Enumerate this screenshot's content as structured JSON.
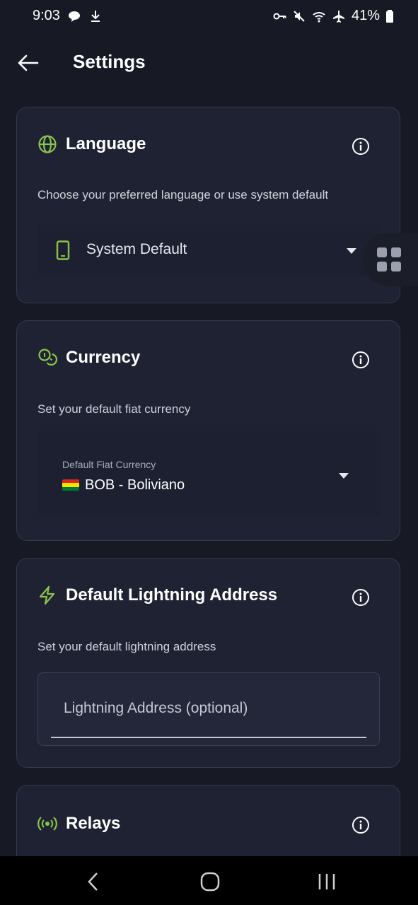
{
  "status_bar": {
    "time": "9:03",
    "battery": "41%",
    "icons": [
      "chat-bubble-icon",
      "download-icon",
      "vpn-key-icon",
      "mute-icon",
      "wifi-icon",
      "airplane-icon",
      "battery-icon"
    ]
  },
  "header": {
    "title": "Settings"
  },
  "language": {
    "title": "Language",
    "description": "Choose your preferred language or use system default",
    "selected": "System Default"
  },
  "currency": {
    "title": "Currency",
    "description": "Set your default fiat currency",
    "field_label": "Default Fiat Currency",
    "selected": "BOB - Boliviano"
  },
  "lightning": {
    "title": "Default Lightning Address",
    "description": "Set your default lightning address",
    "placeholder": "Lightning Address (optional)"
  },
  "relays": {
    "title": "Relays"
  },
  "colors": {
    "accent": "#8bc34a",
    "background": "#171a24",
    "card": "#1e2233"
  }
}
